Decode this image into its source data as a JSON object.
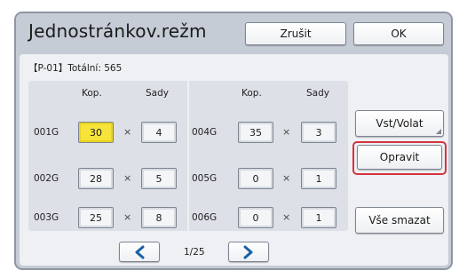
{
  "header": {
    "title": "Jednostránkov.režm",
    "cancel_label": "Zrušit",
    "ok_label": "OK"
  },
  "info": {
    "text": "【P-01】Totální: 565"
  },
  "columns": {
    "left": {
      "kop": "Kop.",
      "sady": "Sady"
    },
    "right": {
      "kop": "Kop.",
      "sady": "Sady"
    }
  },
  "multiply_sign": "×",
  "groups_left": [
    {
      "label": "001G",
      "kop": "30",
      "sady": "4"
    },
    {
      "label": "002G",
      "kop": "28",
      "sady": "5"
    },
    {
      "label": "003G",
      "kop": "25",
      "sady": "8"
    }
  ],
  "groups_right": [
    {
      "label": "004G",
      "kop": "35",
      "sady": "3"
    },
    {
      "label": "005G",
      "kop": "0",
      "sady": "1"
    },
    {
      "label": "006G",
      "kop": "0",
      "sady": "1"
    }
  ],
  "side_buttons": {
    "vst_volat": "Vst/Volat",
    "opravit": "Opravit",
    "vse_smazat": "Vše smazat"
  },
  "pagination": {
    "indicator": "1/25"
  },
  "colors": {
    "active_cell": "#f7e43a",
    "highlight": "#d6343d",
    "arrow": "#1a5fa8"
  }
}
